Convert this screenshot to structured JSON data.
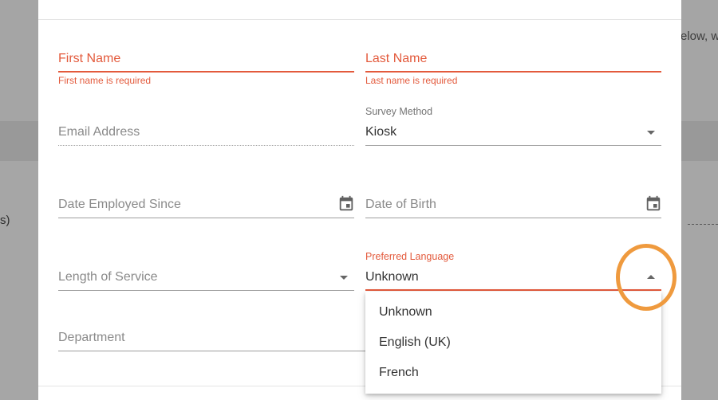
{
  "background": {
    "right_text": "elow, w",
    "left_text": "s)"
  },
  "form": {
    "first_name": {
      "label": "First Name",
      "error": "First name is required"
    },
    "last_name": {
      "label": "Last Name",
      "error": "Last name is required"
    },
    "email": {
      "placeholder": "Email Address"
    },
    "survey_method": {
      "label": "Survey Method",
      "value": "Kiosk"
    },
    "date_employed": {
      "placeholder": "Date Employed Since",
      "icon": "calendar-icon"
    },
    "date_of_birth": {
      "placeholder": "Date of Birth",
      "icon": "calendar-icon"
    },
    "length_of_service": {
      "placeholder": "Length of Service"
    },
    "preferred_language": {
      "label": "Preferred Language",
      "value": "Unknown",
      "options": [
        "Unknown",
        "English (UK)",
        "French"
      ]
    },
    "department": {
      "placeholder": "Department"
    }
  },
  "colors": {
    "error": "#e35a3c",
    "highlight": "#ef9a3e"
  }
}
